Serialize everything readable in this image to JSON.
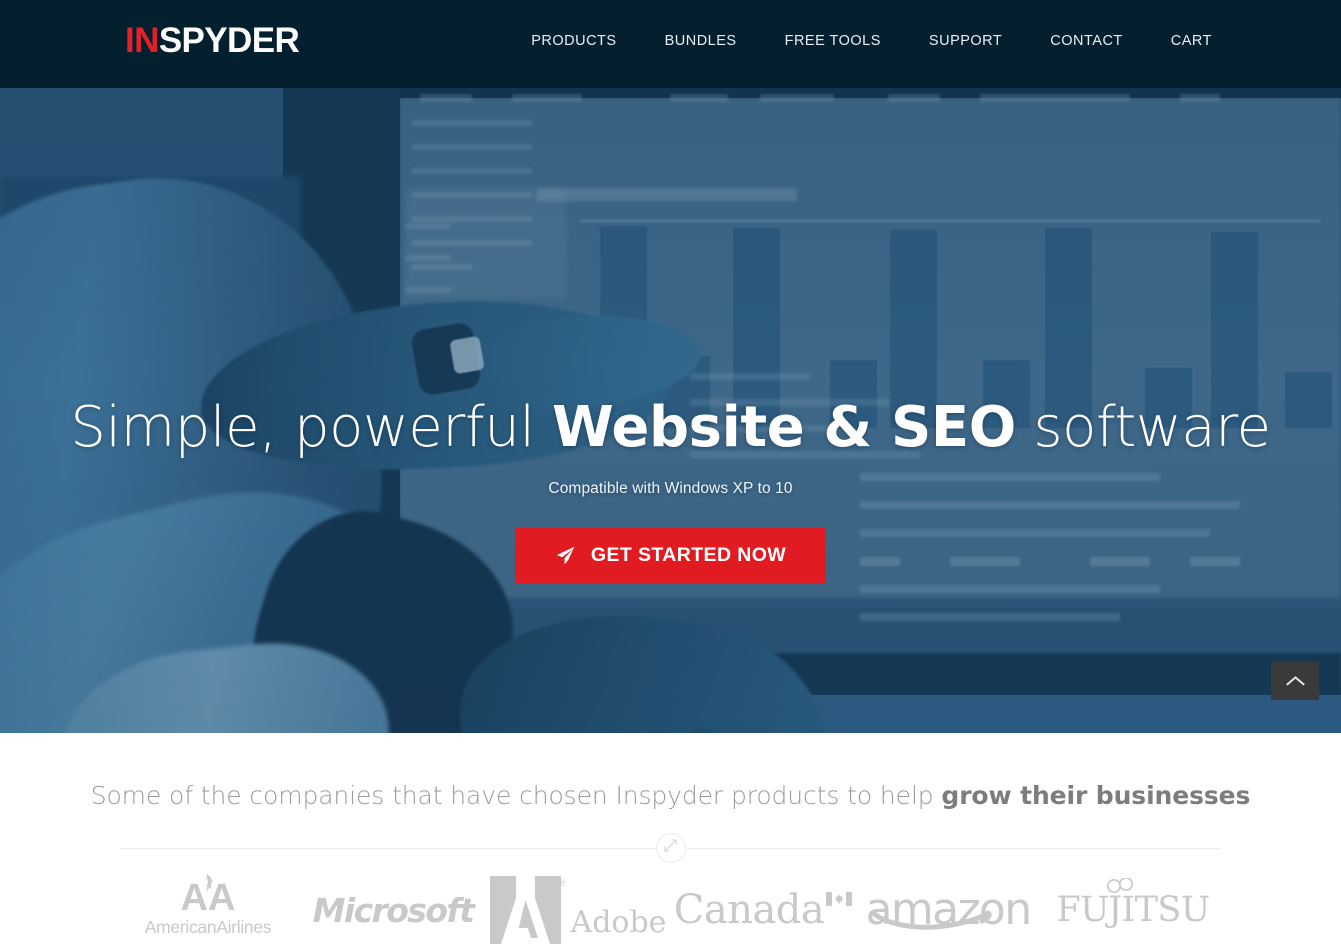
{
  "header": {
    "logo": {
      "part1": "IN",
      "part2": "SPYDER",
      "accent": "#e12229",
      "bg": "#04202f"
    },
    "nav": [
      {
        "label": "PRODUCTS"
      },
      {
        "label": "BUNDLES"
      },
      {
        "label": "FREE TOOLS"
      },
      {
        "label": "SUPPORT"
      },
      {
        "label": "CONTACT"
      },
      {
        "label": "CART"
      }
    ]
  },
  "hero": {
    "title_pre": "Simple, powerful ",
    "title_strong": "Website & SEO",
    "title_post": " software",
    "subtitle": "Compatible with Windows XP to 10",
    "cta": {
      "label": "GET STARTED NOW",
      "icon": "paper-plane-icon",
      "bg": "#e01b22"
    },
    "background": "blurred photo of hands pointing at an analytics dashboard, blue duotone tint",
    "tint": "#2c5274"
  },
  "scroll_top": {
    "icon": "chevron-up-icon",
    "bg": "#3a3a3a"
  },
  "clients": {
    "heading_normal": "Some of the companies that have chosen Inspyder products to help ",
    "heading_bold": "grow their businesses",
    "divider_icon": "expand-arrows-icon",
    "logos": [
      {
        "name": "american-airlines",
        "line1": "A",
        "line2": "A",
        "text": "AmericanAirlines"
      },
      {
        "name": "microsoft",
        "text": "Microsoft"
      },
      {
        "name": "adobe",
        "text": "Adobe",
        "mark": "®"
      },
      {
        "name": "canada",
        "text": "Canada"
      },
      {
        "name": "amazon",
        "text": "amazon"
      },
      {
        "name": "fujitsu",
        "text": "FUJITSU"
      }
    ]
  }
}
